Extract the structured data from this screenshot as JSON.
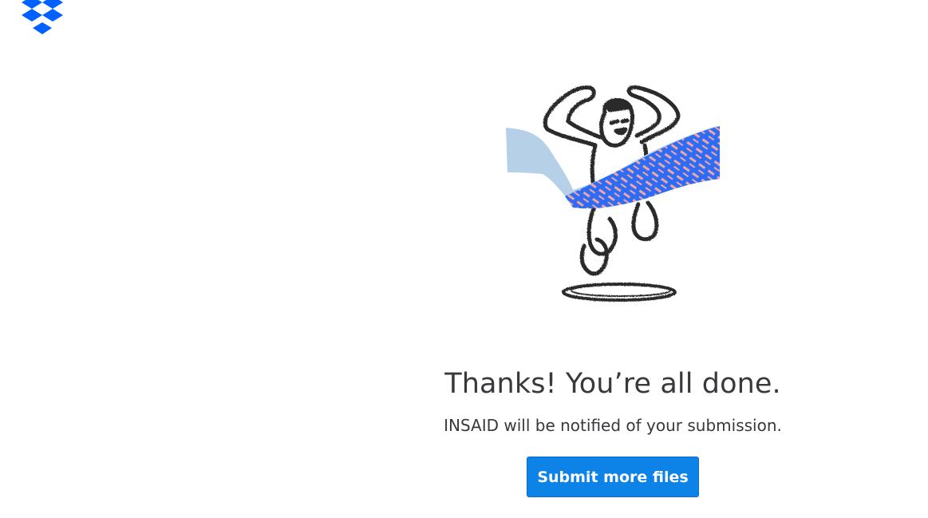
{
  "brand": {
    "logo_icon": "dropbox-logo-icon",
    "color": "#0061fe"
  },
  "illustration": {
    "icon": "celebrating-person-finish-line-illustration"
  },
  "confirmation": {
    "title": "Thanks! You’re all done.",
    "message": "INSAID will be notified of your submission.",
    "button_label": "Submit more files",
    "button_color": "#0d83e8"
  }
}
